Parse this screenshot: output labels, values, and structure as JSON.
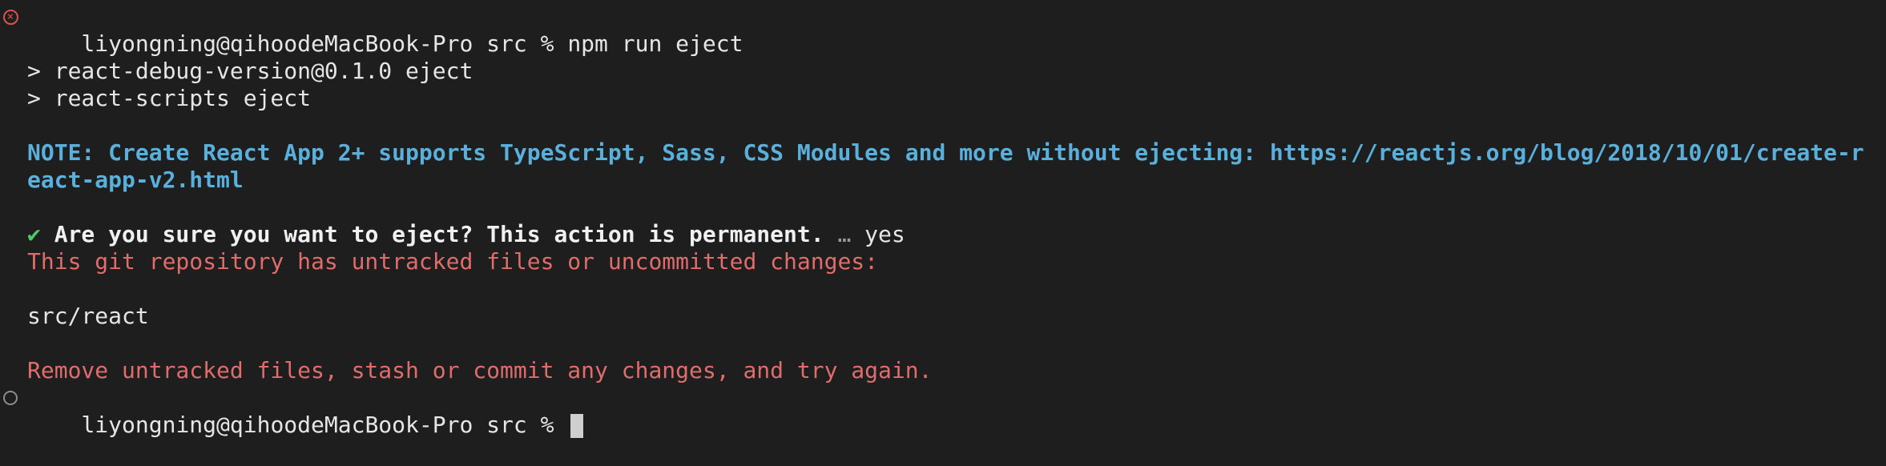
{
  "terminal": {
    "prompt1": {
      "status_icon": "error-x-circle-icon",
      "user_host": "liyongning@qihoodeMacBook-Pro src % ",
      "command": "npm run eject"
    },
    "script_lines": [
      "> react-debug-version@0.1.0 eject",
      "> react-scripts eject"
    ],
    "note_line1": "NOTE: Create React App 2+ supports TypeScript, Sass, CSS Modules and more without ejecting: https://reactjs.org/blog/2018/10/01/create-r",
    "note_line2": "eact-app-v2.html",
    "confirm": {
      "check": "✔",
      "question": "Are you sure you want to eject? This action is permanent.",
      "ellipsis": "…",
      "answer": "yes"
    },
    "git_error": "This git repository has untracked files or uncommitted changes:",
    "untracked_path": "src/react",
    "instruction": "Remove untracked files, stash or commit any changes, and try again.",
    "prompt2": {
      "status_icon": "idle-circle-icon",
      "user_host": "liyongning@qihoodeMacBook-Pro src % "
    },
    "colors": {
      "background": "#1e1e1e",
      "note": "#5ab0dc",
      "error": "#e06c6c",
      "success": "#4ec96b"
    }
  }
}
